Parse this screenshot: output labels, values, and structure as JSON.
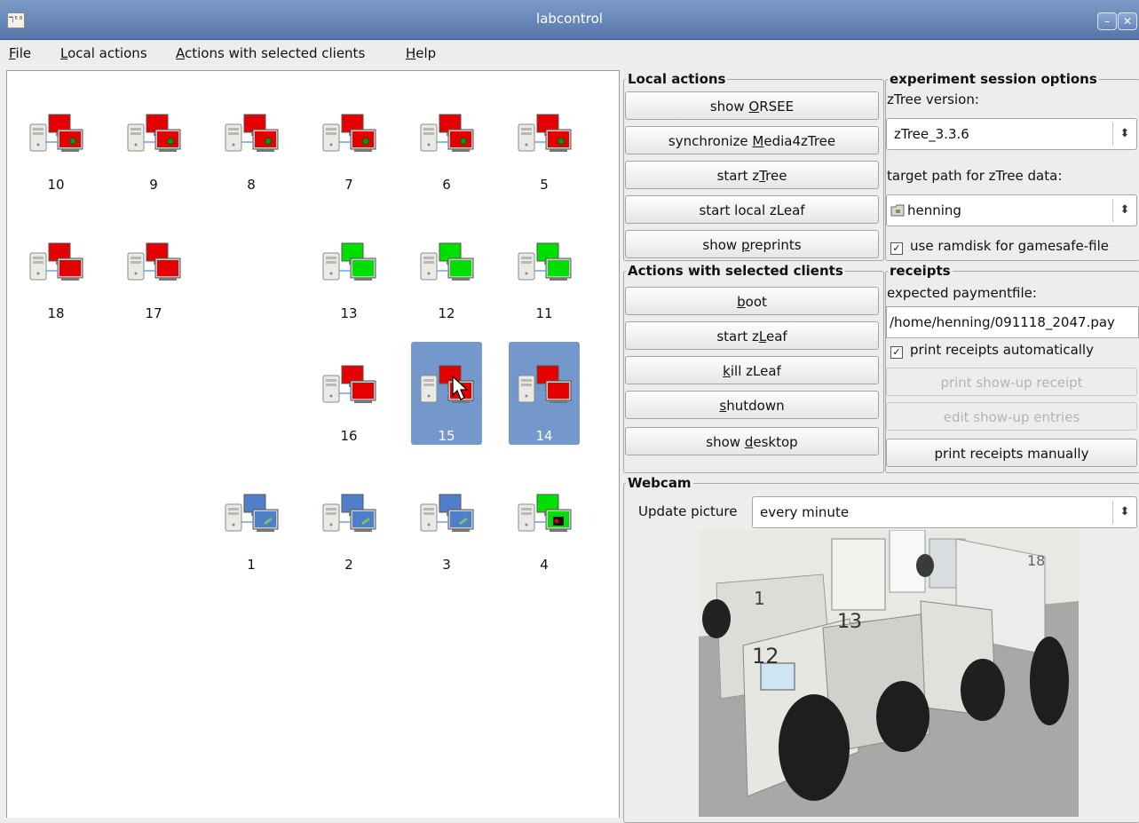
{
  "window": {
    "title": "labcontrol",
    "app_icon": "labcontrol-icon",
    "minimize_glyph": "–",
    "close_glyph": "✕"
  },
  "menubar": {
    "items": [
      {
        "mnemonic": "F",
        "rest": "ile"
      },
      {
        "mnemonic": "L",
        "rest": "ocal actions"
      },
      {
        "mnemonic": "A",
        "rest": "ctions with selected clients"
      },
      {
        "mnemonic": "H",
        "rest": "elp"
      }
    ]
  },
  "clients": [
    {
      "id": "10",
      "screen": "red",
      "dot": true,
      "selected": false
    },
    {
      "id": "9",
      "screen": "red",
      "dot": true,
      "selected": false
    },
    {
      "id": "8",
      "screen": "red",
      "dot": true,
      "selected": false
    },
    {
      "id": "7",
      "screen": "red",
      "dot": true,
      "selected": false
    },
    {
      "id": "6",
      "screen": "red",
      "dot": true,
      "selected": false
    },
    {
      "id": "5",
      "screen": "red",
      "dot": true,
      "selected": false
    },
    {
      "id": "18",
      "screen": "red",
      "dot": false,
      "selected": false
    },
    {
      "id": "17",
      "screen": "red",
      "dot": false,
      "selected": false
    },
    {
      "id": "13",
      "screen": "green",
      "dot": false,
      "selected": false
    },
    {
      "id": "12",
      "screen": "green",
      "dot": false,
      "selected": false
    },
    {
      "id": "11",
      "screen": "green",
      "dot": false,
      "selected": false
    },
    {
      "id": "16",
      "screen": "red",
      "dot": false,
      "selected": false
    },
    {
      "id": "15",
      "screen": "red",
      "dot": false,
      "selected": true,
      "cursor": true
    },
    {
      "id": "14",
      "screen": "red",
      "dot": false,
      "selected": true
    },
    {
      "id": "1",
      "screen": "blue",
      "dot": false,
      "selected": false
    },
    {
      "id": "2",
      "screen": "blue",
      "dot": false,
      "selected": false
    },
    {
      "id": "3",
      "screen": "blue",
      "dot": false,
      "selected": false
    },
    {
      "id": "4",
      "screen": "green-leaf",
      "dot": false,
      "selected": false
    }
  ],
  "colors": {
    "red": "#e40000",
    "green": "#00e000",
    "blue": "#4f7fc8",
    "selection": "#7497cc"
  },
  "local_actions": {
    "legend": "Local actions",
    "buttons": [
      {
        "pre": "show ",
        "mn": "O",
        "post": "RSEE"
      },
      {
        "pre": "synchronize ",
        "mn": "M",
        "post": "edia4zTree"
      },
      {
        "pre": "start z",
        "mn": "T",
        "post": "ree"
      },
      {
        "pre": "start local zLeaf",
        "mn": "",
        "post": ""
      },
      {
        "pre": "show ",
        "mn": "p",
        "post": "reprints"
      }
    ]
  },
  "session_options": {
    "legend": "experiment session options",
    "ztree_version_label": "zTree version:",
    "ztree_version_value": "zTree_3.3.6",
    "target_path_label": "target path for zTree data:",
    "target_path_value": "henning",
    "ramdisk_label": "use ramdisk for gamesafe-file",
    "ramdisk_checked": "✓"
  },
  "client_actions": {
    "legend": "Actions with selected clients",
    "buttons": [
      {
        "pre": "",
        "mn": "b",
        "post": "oot"
      },
      {
        "pre": "start z",
        "mn": "L",
        "post": "eaf"
      },
      {
        "pre": "",
        "mn": "k",
        "post": "ill zLeaf"
      },
      {
        "pre": "",
        "mn": "s",
        "post": "hutdown"
      },
      {
        "pre": "show ",
        "mn": "d",
        "post": "esktop"
      }
    ]
  },
  "receipts": {
    "legend": "receipts",
    "paymentfile_label": "expected paymentfile:",
    "paymentfile_value": "/home/henning/091118_2047.pay",
    "auto_label": "print receipts automatically",
    "auto_checked": "✓",
    "showup_receipt": "print show-up receipt",
    "edit_entries": "edit show-up entries",
    "manual": "print receipts manually"
  },
  "webcam": {
    "legend": "Webcam",
    "update_label": "Update picture",
    "update_value": "every minute",
    "cubicle_numbers": [
      "1",
      "13",
      "12",
      "18"
    ]
  }
}
